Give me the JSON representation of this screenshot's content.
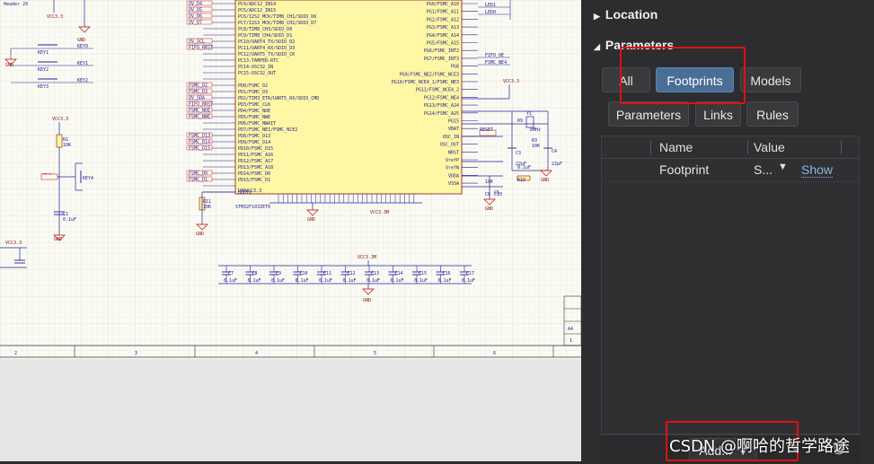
{
  "schematic": {
    "header_label": "Header 2X",
    "power_nets": [
      "VCC3.3",
      "VCC3.3",
      "VCC3.3",
      "VCC3.3M",
      "VCC3.3M",
      "VCC3.3"
    ],
    "gnd_label": "GND",
    "ic_name": "STM32F103ZET6",
    "keys": [
      "KEY1",
      "KEY2",
      "KEY3",
      "KEY4"
    ],
    "key_nets": [
      "KEY0",
      "KEY1",
      "KEY2",
      "KEY3"
    ],
    "left_pins": [
      "PC4/ADC12_IN14",
      "PC5/ADC12_IN15",
      "PC6/I2S2_MCK/TIM8_CH1/SDIO_D6",
      "PC7/I2S3_MCK/TIM8_CH2/SDIO_D7",
      "PC8/TIM8_CH3/SDIO_D0",
      "PC9/TIM8_CH4/SDIO_D1",
      "PC10/UART4_TX/SDIO_D2",
      "PC11/UART4_RX/SDIO_D3",
      "PC12/UART5_TX/SDIO_CK",
      "PC13-TAMPER-RTC",
      "PC14-OSC32_IN",
      "PC15-OSC32_OUT",
      "",
      "PD0/FSMC_D2",
      "PD1/FSMC_D3",
      "PD2/TIM3_ETR/UART5_RX/SDIO_CMD",
      "PD3/FSMC_CLK",
      "PD4/FSMC_NOE",
      "PD5/FSMC_NWE",
      "PD6/FSMC_NWAIT",
      "PD7/FSMC_NE1/FSMC_NCE2",
      "PD8/FSMC_D13",
      "PD9/FSMC_D14",
      "PD10/FSMC_D15",
      "PD11/FSMC_A16",
      "PD12/FSMC_A17",
      "PD13/FSMC_A18",
      "PD14/FSMC_D0",
      "PD15/FSMC_D1",
      "",
      "BOOT0"
    ],
    "right_pins": [
      "PG0/FSMC_A10",
      "PG1/FSMC_A11",
      "PG2/FSMC_A12",
      "PG3/FSMC_A13",
      "PG4/FSMC_A14",
      "PG5/FSMC_A15",
      "PG6/FSMC_INT2",
      "PG7/FSMC_INT3",
      "PG8",
      "PG9/FSMC_NE2/FSMC_NCE3",
      "PG10/FSMC_NCE4_1/FSMC_NE3",
      "PG11/FSMC_NCE4_2",
      "PG12/FSMC_NE4",
      "PG13/FSMC_A24",
      "PG14/FSMC_A25",
      "PG15",
      "VBAT",
      "OSC_IN",
      "OSC_OUT",
      "NRST",
      "VrefP",
      "VrefN",
      "VDDA",
      "VSSA"
    ],
    "left_nets": [
      "OV_D4",
      "OV_D5",
      "OV_D6",
      "OV_D7",
      "",
      "",
      "OV_SCL",
      "FIFO_RRST",
      "",
      "",
      "",
      "",
      "",
      "FSMC_D2",
      "FSMC_D3",
      "OV_SDA",
      "FIFO_RRST",
      "FSMC_NOE",
      "FSMC_NWE",
      "",
      "",
      "FSMC_D13",
      "FSMC_D14",
      "FSMC_D15",
      "",
      "",
      "",
      "FSMC_D0",
      "FSMC_D1"
    ],
    "right_nets": [
      "LED1",
      "LED0",
      "FIFO_OE",
      "FSMC_NE4"
    ],
    "caps": [
      "C7",
      "C8",
      "C9",
      "C10",
      "C11",
      "C12",
      "C13",
      "C14",
      "C15",
      "C16",
      "C17"
    ],
    "cap_value": "0.1uF",
    "misc_labels": [
      "R1",
      "10K",
      "C1",
      "0.1uF",
      "R3",
      "10K",
      "C3",
      "22pF",
      "C4",
      "22pF",
      "Y1",
      "8MHz",
      "R11",
      "10K",
      "RESET",
      "R9",
      "10K",
      "C5",
      "C6",
      "C10",
      "0.1uF",
      "R10",
      "10RVCC3.3",
      "BOOT0"
    ],
    "ruler": [
      "2",
      "3",
      "4",
      "5",
      "6"
    ],
    "title_block": [
      "A4",
      "1"
    ]
  },
  "panel": {
    "location_label": "Location",
    "parameters_label": "Parameters",
    "filter_buttons": [
      "All",
      "Footprints",
      "Models",
      "Parameters",
      "Links",
      "Rules"
    ],
    "active_filter": "Footprints",
    "columns": [
      "Name",
      "Value"
    ],
    "rows": [
      {
        "name": "Footprint",
        "value": "S...",
        "action": "Show"
      }
    ],
    "add_label": "Add...",
    "colors": {
      "active": "#4a6f96",
      "link": "#8fb4de",
      "highlight": "#e01010"
    }
  },
  "watermark": "CSDN @啊哈的哲学路途"
}
